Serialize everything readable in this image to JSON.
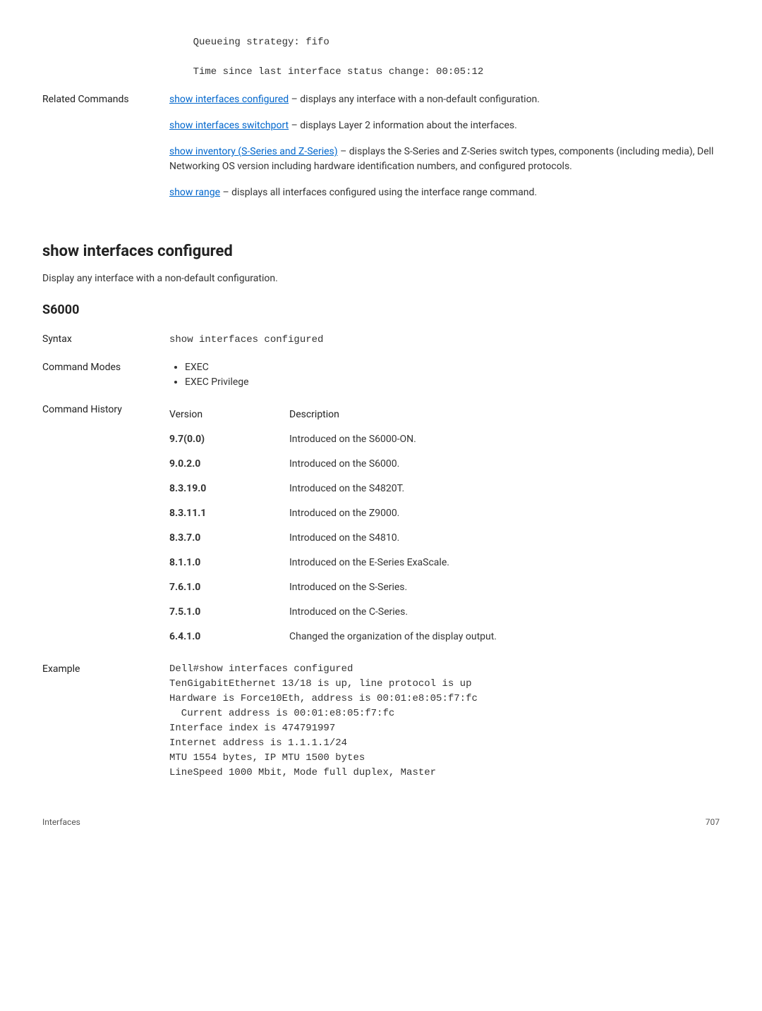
{
  "top_code": "    Queueing strategy: fifo\n\n    Time since last interface status change: 00:05:12",
  "related": {
    "label": "Related Commands",
    "items": [
      {
        "link": "show interfaces configured",
        "suffix": " – displays any interface with a non-default configuration."
      },
      {
        "link": "show interfaces switchport",
        "suffix": " – displays Layer 2 information about the interfaces."
      },
      {
        "link": "show inventory (S-Series and Z-Series)",
        "suffix": " – displays the S-Series and Z-Series switch types, components (including media), Dell Networking OS version including hardware identification numbers, and configured protocols."
      },
      {
        "link": "show range",
        "suffix": " – displays all interfaces configured using the interface range command."
      }
    ]
  },
  "section_title": "show interfaces configured",
  "section_desc": "Display any interface with a non-default configuration.",
  "platform": "S6000",
  "syntax_label": "Syntax",
  "syntax_value": "show interfaces configured",
  "modes_label": "Command Modes",
  "modes": [
    "EXEC",
    "EXEC Privilege"
  ],
  "history_label": "Command History",
  "history_headers": {
    "version": "Version",
    "description": "Description"
  },
  "history": [
    {
      "v": "9.7(0.0)",
      "d": "Introduced on the S6000-ON."
    },
    {
      "v": "9.0.2.0",
      "d": "Introduced on the S6000."
    },
    {
      "v": "8.3.19.0",
      "d": "Introduced on the S4820T."
    },
    {
      "v": "8.3.11.1",
      "d": "Introduced on the Z9000."
    },
    {
      "v": "8.3.7.0",
      "d": "Introduced on the S4810."
    },
    {
      "v": "8.1.1.0",
      "d": "Introduced on the E-Series ExaScale."
    },
    {
      "v": "7.6.1.0",
      "d": "Introduced on the S-Series."
    },
    {
      "v": "7.5.1.0",
      "d": "Introduced on the C-Series."
    },
    {
      "v": "6.4.1.0",
      "d": "Changed the organization of the display output."
    }
  ],
  "example_label": "Example",
  "example_code": "Dell#show interfaces configured\nTenGigabitEthernet 13/18 is up, line protocol is up\nHardware is Force10Eth, address is 00:01:e8:05:f7:fc\n  Current address is 00:01:e8:05:f7:fc\nInterface index is 474791997\nInternet address is 1.1.1.1/24\nMTU 1554 bytes, IP MTU 1500 bytes\nLineSpeed 1000 Mbit, Mode full duplex, Master",
  "footer_left": "Interfaces",
  "footer_right": "707"
}
